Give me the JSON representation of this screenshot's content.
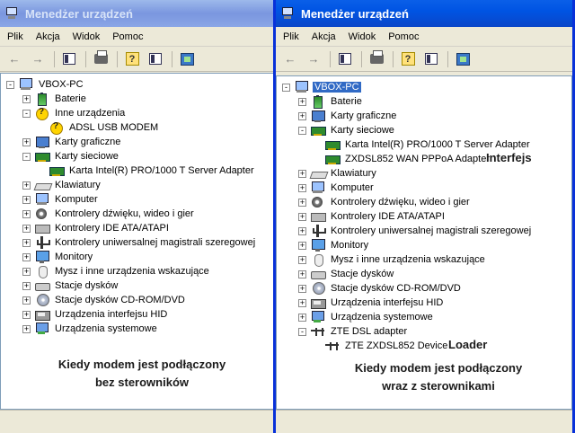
{
  "left": {
    "title": "Menedżer urządzeń",
    "menu": [
      "Plik",
      "Akcja",
      "Widok",
      "Pomoc"
    ],
    "tree": [
      {
        "label": "VBOX-PC",
        "icon": "computer-icon",
        "depth": 0,
        "exp": "-"
      },
      {
        "label": "Baterie",
        "icon": "battery-icon",
        "depth": 1,
        "exp": "+"
      },
      {
        "label": "Inne urządzenia",
        "icon": "unknown-device-icon",
        "depth": 1,
        "exp": "-"
      },
      {
        "label": "ADSL USB MODEM",
        "icon": "unknown-device-icon",
        "depth": 2,
        "exp": ""
      },
      {
        "label": "Karty graficzne",
        "icon": "display-adapter-icon",
        "depth": 1,
        "exp": "+"
      },
      {
        "label": "Karty sieciowe",
        "icon": "network-adapter-icon",
        "depth": 1,
        "exp": "-"
      },
      {
        "label": "Karta Intel(R) PRO/1000 T Server Adapter",
        "icon": "network-adapter-icon",
        "depth": 2,
        "exp": ""
      },
      {
        "label": "Klawiatury",
        "icon": "keyboard-icon",
        "depth": 1,
        "exp": "+"
      },
      {
        "label": "Komputer",
        "icon": "computer-icon",
        "depth": 1,
        "exp": "+"
      },
      {
        "label": "Kontrolery dźwięku, wideo i gier",
        "icon": "sound-icon",
        "depth": 1,
        "exp": "+"
      },
      {
        "label": "Kontrolery IDE ATA/ATAPI",
        "icon": "ide-controller-icon",
        "depth": 1,
        "exp": "+"
      },
      {
        "label": "Kontrolery uniwersalnej magistrali szeregowej",
        "icon": "usb-icon",
        "depth": 1,
        "exp": "+"
      },
      {
        "label": "Monitory",
        "icon": "monitor-icon",
        "depth": 1,
        "exp": "+"
      },
      {
        "label": "Mysz i inne urządzenia wskazujące",
        "icon": "mouse-icon",
        "depth": 1,
        "exp": "+"
      },
      {
        "label": "Stacje dysków",
        "icon": "disk-drive-icon",
        "depth": 1,
        "exp": "+"
      },
      {
        "label": "Stacje dysków CD-ROM/DVD",
        "icon": "cdrom-icon",
        "depth": 1,
        "exp": "+"
      },
      {
        "label": "Urządzenia interfejsu HID",
        "icon": "hid-icon",
        "depth": 1,
        "exp": "+"
      },
      {
        "label": "Urządzenia systemowe",
        "icon": "system-device-icon",
        "depth": 1,
        "exp": "+"
      }
    ],
    "caption_line1": "Kiedy modem jest podłączony",
    "caption_line2": "bez sterowników"
  },
  "right": {
    "title": "Menedżer urządzeń",
    "menu": [
      "Plik",
      "Akcja",
      "Widok",
      "Pomoc"
    ],
    "tree": [
      {
        "label": "VBOX-PC",
        "icon": "computer-icon",
        "depth": 0,
        "exp": "-",
        "selected": true
      },
      {
        "label": "Baterie",
        "icon": "battery-icon",
        "depth": 1,
        "exp": "+"
      },
      {
        "label": "Karty graficzne",
        "icon": "display-adapter-icon",
        "depth": 1,
        "exp": "+"
      },
      {
        "label": "Karty sieciowe",
        "icon": "network-adapter-icon",
        "depth": 1,
        "exp": "-"
      },
      {
        "label": "Karta Intel(R) PRO/1000 T Server Adapter",
        "icon": "network-adapter-icon",
        "depth": 2,
        "exp": ""
      },
      {
        "label": "ZXDSL852 WAN PPPoA Adapter",
        "icon": "network-adapter-icon",
        "depth": 2,
        "exp": ""
      },
      {
        "label": "Klawiatury",
        "icon": "keyboard-icon",
        "depth": 1,
        "exp": "+"
      },
      {
        "label": "Komputer",
        "icon": "computer-icon",
        "depth": 1,
        "exp": "+"
      },
      {
        "label": "Kontrolery dźwięku, wideo i gier",
        "icon": "sound-icon",
        "depth": 1,
        "exp": "+"
      },
      {
        "label": "Kontrolery IDE ATA/ATAPI",
        "icon": "ide-controller-icon",
        "depth": 1,
        "exp": "+"
      },
      {
        "label": "Kontrolery uniwersalnej magistrali szeregowej",
        "icon": "usb-icon",
        "depth": 1,
        "exp": "+"
      },
      {
        "label": "Monitory",
        "icon": "monitor-icon",
        "depth": 1,
        "exp": "+"
      },
      {
        "label": "Mysz i inne urządzenia wskazujące",
        "icon": "mouse-icon",
        "depth": 1,
        "exp": "+"
      },
      {
        "label": "Stacje dysków",
        "icon": "disk-drive-icon",
        "depth": 1,
        "exp": "+"
      },
      {
        "label": "Stacje dysków CD-ROM/DVD",
        "icon": "cdrom-icon",
        "depth": 1,
        "exp": "+"
      },
      {
        "label": "Urządzenia interfejsu HID",
        "icon": "hid-icon",
        "depth": 1,
        "exp": "+"
      },
      {
        "label": "Urządzenia systemowe",
        "icon": "system-device-icon",
        "depth": 1,
        "exp": "+"
      },
      {
        "label": "ZTE DSL adapter",
        "icon": "zte-adapter-icon",
        "depth": 1,
        "exp": "-"
      },
      {
        "label": "ZTE ZXDSL852 Device",
        "icon": "zte-adapter-icon",
        "depth": 2,
        "exp": ""
      }
    ],
    "tag_interface": "Interfejs",
    "tag_loader": "Loader",
    "caption_line1": "Kiedy modem jest podłączony",
    "caption_line2": "wraz z sterownikami"
  }
}
